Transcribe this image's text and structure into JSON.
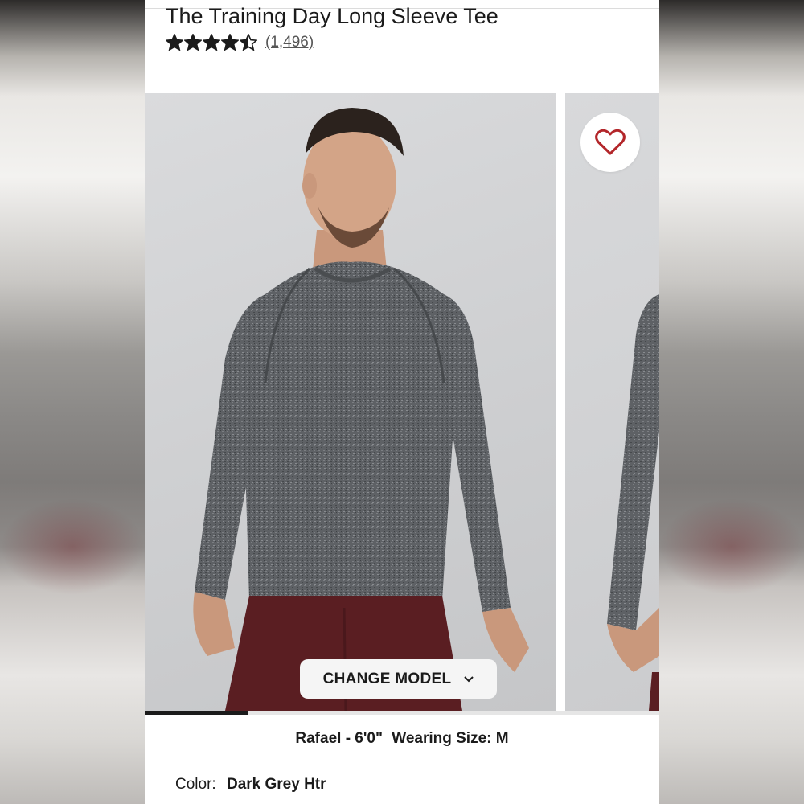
{
  "product": {
    "title": "The Training Day Long Sleeve Tee",
    "rating": 4.5,
    "rating_stars_total": 5,
    "review_count": "(1,496)"
  },
  "gallery": {
    "change_model_label": "CHANGE MODEL",
    "wishlist_icon": "heart-outline-icon",
    "progress": 0.2
  },
  "model_info": {
    "name_height": "Rafael - 6'0\"",
    "wearing_size": "Wearing Size: M"
  },
  "color": {
    "label": "Color:",
    "value": "Dark Grey Htr"
  },
  "colors": {
    "accent_heart": "#b3262a",
    "text": "#1b1b1b",
    "shirt": "#5c5f63",
    "shorts": "#5a1e22"
  }
}
